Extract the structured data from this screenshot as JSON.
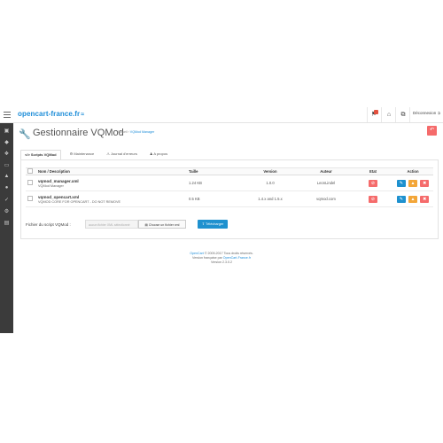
{
  "header": {
    "logo_text": "opencart-france.fr",
    "logo_mark": "≈",
    "logout_label": "Déconnexion"
  },
  "sidebar": {
    "icons": [
      "dashboard-icon",
      "tag-icon",
      "puzzle-icon",
      "desktop-icon",
      "cart-icon",
      "user-icon",
      "share-icon",
      "gear-icon",
      "chart-icon"
    ]
  },
  "page": {
    "title": "Gestionnaire VQMod",
    "breadcrumb_home": "Accueil",
    "breadcrumb_sep": "›",
    "breadcrumb_current": "VQMod Manager"
  },
  "tabs": [
    "Scripts VQMod",
    "Maintenance",
    "Journal d'erreurs",
    "A propos"
  ],
  "table": {
    "headers": [
      "Nom / Description",
      "Taille",
      "Version",
      "Auteur",
      "Etat",
      "Action"
    ],
    "rows": [
      {
        "name": "vqmod_manager.xml",
        "desc": "VQMod Manager",
        "size": "1.24 KB",
        "version": "1.0.0",
        "author": "LeonLindel"
      },
      {
        "name": "vqmod_opencart.xml",
        "desc": "VQMOD CORE FOR OPENCART - DO NOT REMOVE",
        "size": "0.5 KB",
        "version": "1.4.x and 1.5.x",
        "author": "vqmod.com"
      }
    ]
  },
  "upload": {
    "label": "Fichier du script VQMod :",
    "placeholder": "aucun fichier XML sélectionné",
    "choose_label": "Choose un fichier xml",
    "send_label": "Télécharger"
  },
  "footer": {
    "line1_link": "OpenCart",
    "line1_text": " © 2009-2017 Tous droits réservés.",
    "line2_text": "Version française par ",
    "line2_link": "OpenCart-France.fr",
    "line3": "Version 2.3.0.2"
  },
  "colors": {
    "accent": "#1e91cf",
    "danger": "#f56b6b",
    "warning": "#f3a638",
    "sidebar": "#3b3b3b"
  }
}
